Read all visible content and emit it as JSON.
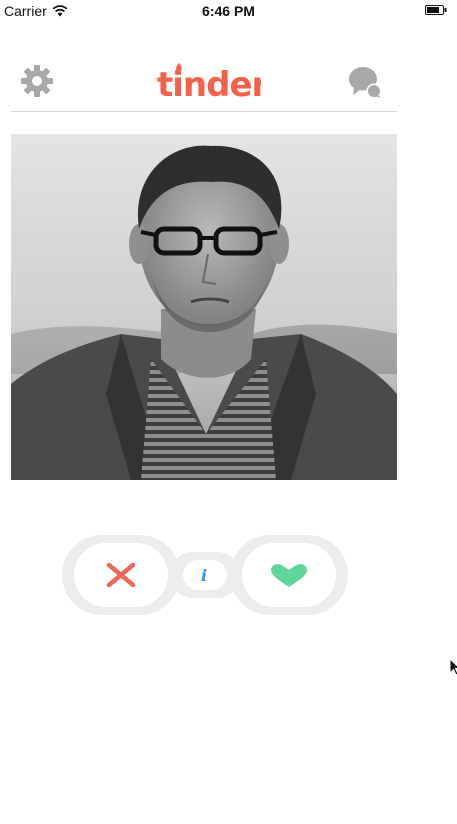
{
  "status_bar": {
    "carrier": "Carrier",
    "time": "6:46 PM"
  },
  "header": {
    "logo_text": "tinder",
    "settings_icon": "gear-icon",
    "messages_icon": "chat-bubbles-icon"
  },
  "card": {
    "photo": "profile-photo"
  },
  "actions": {
    "dislike_icon": "x-icon",
    "info_icon": "info-icon",
    "info_label": "i",
    "like_icon": "heart-icon"
  },
  "colors": {
    "brand": "#f3614a",
    "dislike": "#f0664e",
    "info": "#2d8ff0",
    "like": "#5ed69a",
    "icon_gray": "#a8a8a8",
    "ring": "#ececec"
  }
}
